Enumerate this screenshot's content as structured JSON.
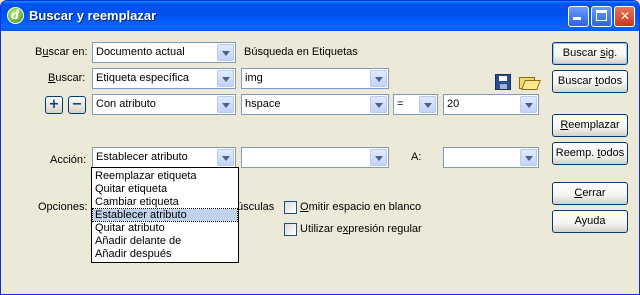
{
  "window": {
    "title": "Buscar y reemplazar"
  },
  "find_in": {
    "label_pre": "B",
    "label_u": "u",
    "label_post": "scar en:",
    "value": "Documento actual",
    "scope_text": "Búsqueda en Etiquetas"
  },
  "search": {
    "label_u": "B",
    "label_post": "uscar:",
    "type_value": "Etiqueta específica",
    "tag_value": "img"
  },
  "condition": {
    "plus": "+",
    "minus": "−",
    "value": "Con atributo",
    "attribute": "hspace",
    "operator": "=",
    "number": "20"
  },
  "action": {
    "label": "Acción:",
    "value": "Establecer atributo",
    "target": "",
    "a_label": "A:",
    "a_value": ""
  },
  "action_options": [
    "Reemplazar etiqueta",
    "Quitar etiqueta",
    "Cambiar etiqueta",
    "Establecer atributo",
    "Quitar atributo",
    "Añadir delante de",
    "Añadir después"
  ],
  "options": {
    "label": "Opciones:",
    "partial_hidden": "úsculas",
    "ignore_ws": {
      "pre": "",
      "u": "O",
      "post": "mitir espacio en blanco"
    },
    "regex": {
      "pre": "Utilizar e",
      "u": "x",
      "post": "presión regular"
    }
  },
  "buttons": {
    "find_next": {
      "pre": "Buscar ",
      "u": "s",
      "post": "ig."
    },
    "find_all": {
      "pre": "Buscar ",
      "u": "t",
      "post": "odos"
    },
    "replace": {
      "pre": "",
      "u": "R",
      "post": "eemplazar"
    },
    "replace_all": {
      "pre": "Reemp. ",
      "u": "t",
      "post": "odos"
    },
    "close": {
      "pre": "",
      "u": "C",
      "post": "errar"
    },
    "help": {
      "pre": "Ayuda",
      "u": "",
      "post": ""
    }
  },
  "title_controls": {
    "close": "✕"
  },
  "icons": {
    "app": "dreamweaver-icon",
    "save": "save-query-icon",
    "open": "load-query-icon"
  }
}
